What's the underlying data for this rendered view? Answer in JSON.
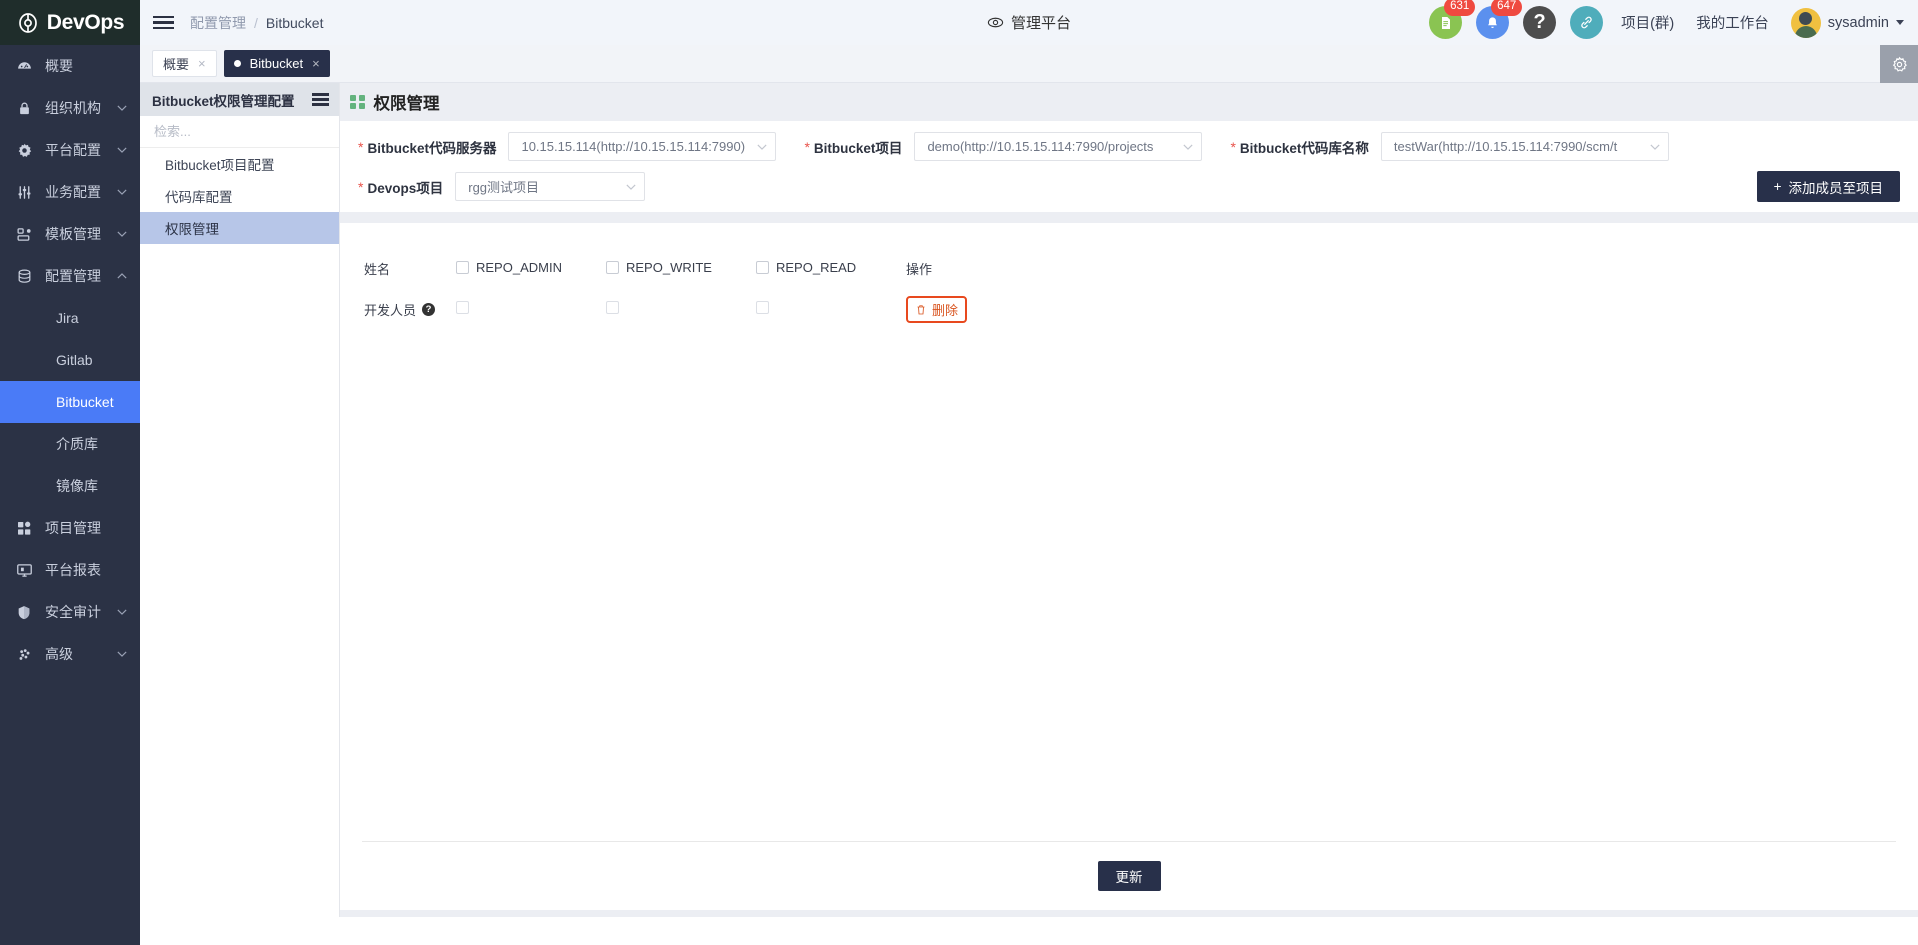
{
  "brand": {
    "name": "DevOps",
    "logo_icon": "devops-logo-icon"
  },
  "topbar": {
    "menu_icon": "hamburger-menu-icon",
    "breadcrumb": {
      "parent": "配置管理",
      "separator": "/",
      "current": "Bitbucket"
    },
    "center_title": "管理平台",
    "center_icon": "eye-icon",
    "icons": [
      {
        "name": "document-icon",
        "glyph": "☰",
        "color": "#8ac452",
        "badge": "631"
      },
      {
        "name": "bell-icon",
        "glyph": "▲",
        "color": "#5b90ee",
        "badge": "647"
      },
      {
        "name": "help-icon",
        "glyph": "?",
        "color": "#4d4d4d",
        "badge": ""
      },
      {
        "name": "link-icon",
        "glyph": "⚭",
        "color": "#4fadbb",
        "badge": ""
      }
    ],
    "links": [
      "项目(群)",
      "我的工作台"
    ],
    "user": "sysadmin"
  },
  "sidebar": {
    "items": [
      {
        "label": "概要",
        "icon": "dashboard-icon",
        "expandable": false,
        "expanded": false
      },
      {
        "label": "组织机构",
        "icon": "lock-icon",
        "expandable": true,
        "expanded": false
      },
      {
        "label": "平台配置",
        "icon": "gear-icon",
        "expandable": true,
        "expanded": false
      },
      {
        "label": "业务配置",
        "icon": "sliders-icon",
        "expandable": true,
        "expanded": false
      },
      {
        "label": "模板管理",
        "icon": "template-icon",
        "expandable": true,
        "expanded": false
      },
      {
        "label": "配置管理",
        "icon": "database-icon",
        "expandable": true,
        "expanded": true
      }
    ],
    "sub_items": [
      {
        "label": "Jira",
        "active": false
      },
      {
        "label": "Gitlab",
        "active": false
      },
      {
        "label": "Bitbucket",
        "active": true
      },
      {
        "label": "介质库",
        "active": false
      },
      {
        "label": "镜像库",
        "active": false
      }
    ],
    "items_after": [
      {
        "label": "项目管理",
        "icon": "grid-icon",
        "expandable": false,
        "expanded": false
      },
      {
        "label": "平台报表",
        "icon": "report-icon",
        "expandable": false,
        "expanded": false
      },
      {
        "label": "安全审计",
        "icon": "shield-icon",
        "expandable": true,
        "expanded": false
      },
      {
        "label": "高级",
        "icon": "advanced-icon",
        "expandable": true,
        "expanded": false
      }
    ],
    "active_color": "#4a7bf7",
    "bg_color": "#2b3245"
  },
  "tabbar": {
    "tabs": [
      {
        "label": "概要",
        "active": false,
        "close": "×"
      },
      {
        "label": "Bitbucket",
        "active": true,
        "close": "×"
      }
    ],
    "gear_icon": "settings-gear-icon"
  },
  "subpanel": {
    "title": "Bitbucket权限管理配置",
    "collapse_icon": "panel-toggle-icon",
    "search": {
      "placeholder": "检索...",
      "value": "",
      "icon": "search-icon"
    },
    "items": [
      {
        "label": "Bitbucket项目配置",
        "active": false
      },
      {
        "label": "代码库配置",
        "active": false
      },
      {
        "label": "权限管理",
        "active": true
      }
    ]
  },
  "page": {
    "title": "权限管理",
    "title_icon": "grid-squares-icon",
    "fields": [
      {
        "label": "Bitbucket代码服务器",
        "value": "10.15.15.114(http://10.15.15.114:7990)",
        "required": true,
        "width": "sel-w1"
      },
      {
        "label": "Bitbucket项目",
        "value": "demo(http://10.15.15.114:7990/projects",
        "required": true,
        "width": "sel-w2"
      },
      {
        "label": "Bitbucket代码库名称",
        "value": "testWar(http://10.15.15.114:7990/scm/t",
        "required": true,
        "width": "sel-w3"
      },
      {
        "label": "Devops项目",
        "value": "rgg测试项目",
        "required": true,
        "width": "sel-w4"
      }
    ],
    "add_member_button": {
      "label": "添加成员至项目",
      "icon": "plus-icon"
    },
    "table": {
      "headers": {
        "name": "姓名",
        "perms": [
          "REPO_ADMIN",
          "REPO_WRITE",
          "REPO_READ"
        ],
        "operation": "操作"
      },
      "rows": [
        {
          "name": "开发人员",
          "has_help_icon": true,
          "help_glyph": "?",
          "checks": [
            false,
            false,
            false
          ],
          "action": {
            "label": "删除",
            "icon": "trash-icon",
            "highlighted": true
          }
        }
      ]
    },
    "update_button": "更新"
  },
  "colors": {
    "accent_blue": "#4a7bf7",
    "dark_navy": "#28304a",
    "required_red": "#e8524a",
    "highlight_orange": "#e8491e",
    "badge_red": "#ef4a40"
  }
}
